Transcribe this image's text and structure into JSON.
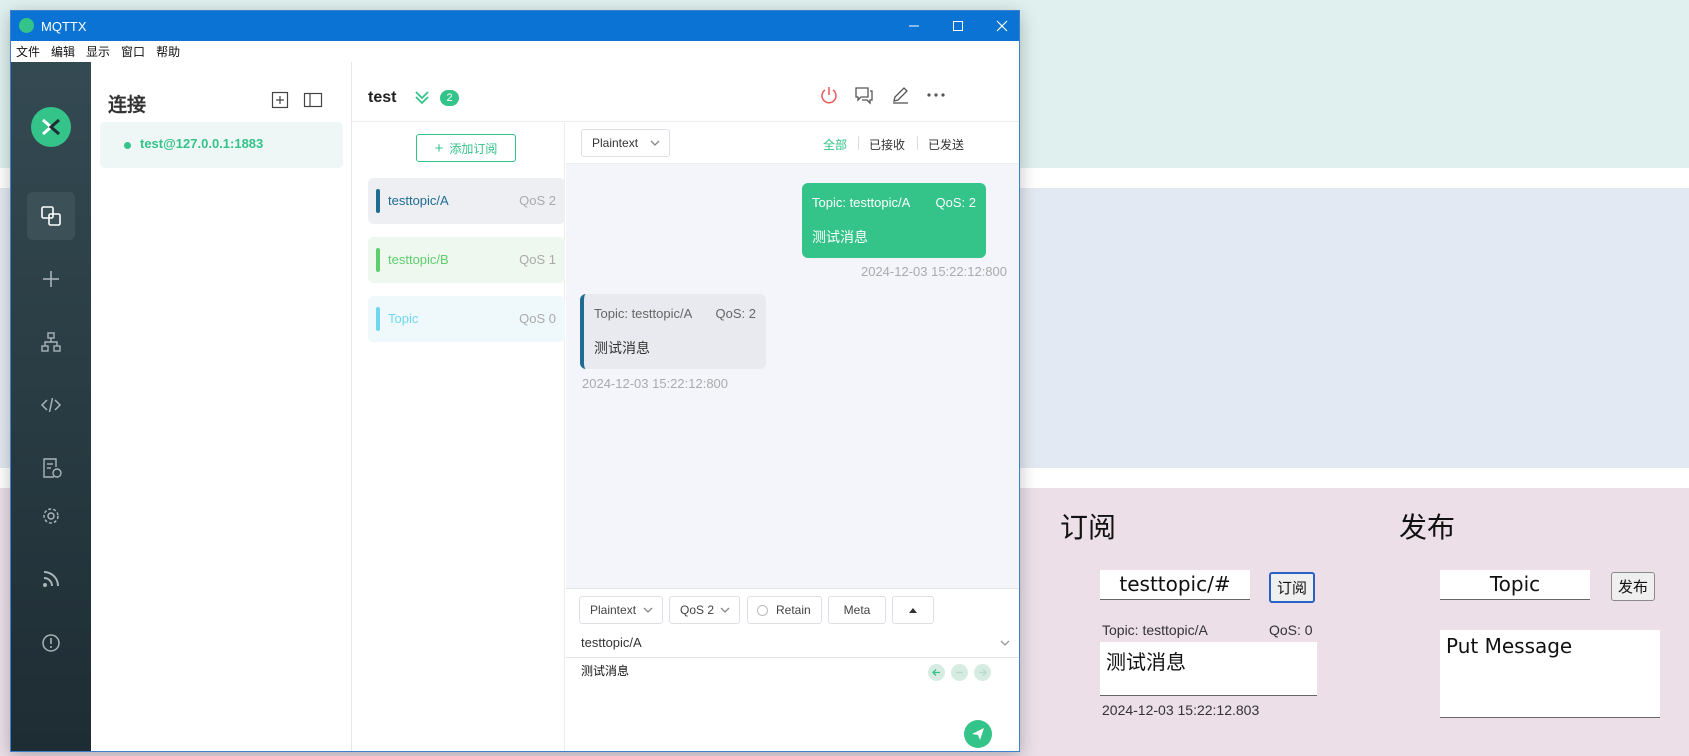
{
  "window": {
    "title": "MQTTX",
    "menu": [
      "文件",
      "编辑",
      "显示",
      "窗口",
      "帮助"
    ]
  },
  "connections": {
    "title": "连接",
    "items": [
      {
        "label": "test@127.0.0.1:1883",
        "status": "connected"
      }
    ]
  },
  "connection_view": {
    "name": "test",
    "subscription_count": "2",
    "add_subscription_label": "添加订阅",
    "subscriptions": [
      {
        "topic": "testtopic/A",
        "qos": "QoS 2",
        "color": "#1f6c92"
      },
      {
        "topic": "testtopic/B",
        "qos": "QoS 1",
        "color": "#5dce6e"
      },
      {
        "topic": "Topic",
        "qos": "QoS 0",
        "color": "#6fd7f0"
      }
    ],
    "messages_header": {
      "format": "Plaintext",
      "filters": [
        "全部",
        "已接收",
        "已发送"
      ],
      "active_filter": "全部"
    },
    "messages": [
      {
        "direction": "out",
        "topic": "Topic: testtopic/A",
        "qos": "QoS: 2",
        "payload": "测试消息",
        "time": "2024-12-03 15:22:12:800"
      },
      {
        "direction": "in",
        "topic": "Topic: testtopic/A",
        "qos": "QoS: 2",
        "payload": "测试消息",
        "time": "2024-12-03 15:22:12:800"
      }
    ],
    "publish": {
      "format": "Plaintext",
      "qos": "QoS 2",
      "retain_label": "Retain",
      "meta_label": "Meta",
      "topic": "testtopic/A",
      "payload": "测试消息"
    }
  },
  "web_page": {
    "subscribe_heading": "订阅",
    "publish_heading": "发布",
    "subscribe_topic": "testtopic/#",
    "subscribe_button": "订阅",
    "received_topic": "Topic: testtopic/A",
    "received_qos": "QoS: 0",
    "received_payload": "测试消息",
    "received_time": "2024-12-03 15:22:12.803",
    "publish_topic": "Topic",
    "publish_button": "发布",
    "publish_message_placeholder": "Put Message"
  },
  "colors": {
    "accent": "#34c388",
    "titlebar": "#0a73d4",
    "rail": "#2a3a42"
  }
}
